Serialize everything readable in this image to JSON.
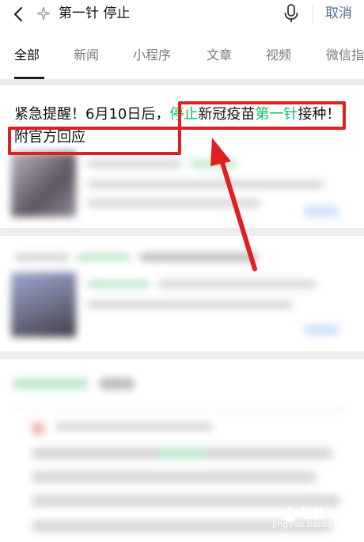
{
  "search": {
    "query": "第一针 停止",
    "cancel_label": "取消"
  },
  "tabs": [
    {
      "label": "全部"
    },
    {
      "label": "新闻"
    },
    {
      "label": "小程序"
    },
    {
      "label": "文章"
    },
    {
      "label": "视频"
    },
    {
      "label": "微信指"
    }
  ],
  "results": [
    {
      "title_part1": "紧急提醒！6月10日后，",
      "title_hl1": "停止",
      "title_part2": "新冠疫苗",
      "title_hl2": "第一针",
      "title_part3": "接种！附官方回应"
    }
  ],
  "watermark": {
    "brand": "经验",
    "url": "jingyan.baidu.com"
  },
  "colors": {
    "highlight": "#07c160",
    "link": "#576b95",
    "annotation": "#e02020"
  }
}
